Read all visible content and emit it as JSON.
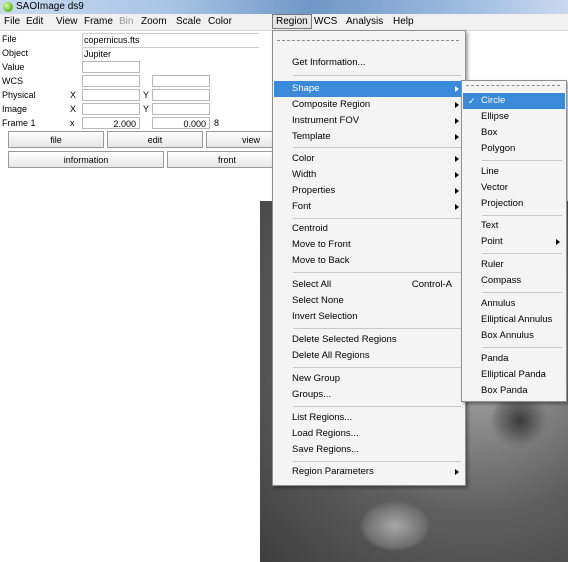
{
  "window": {
    "title": "SAOImage ds9"
  },
  "menubar": [
    "File",
    "Edit",
    "View",
    "Frame",
    "Bin",
    "Zoom",
    "Scale",
    "Color",
    "Region",
    "WCS",
    "Analysis",
    "Help"
  ],
  "info_panel": {
    "file_label": "File",
    "file_value": "copernicus.fts",
    "object_label": "Object",
    "object_value": "Jupiter",
    "value_label": "Value",
    "wcs_label": "WCS",
    "physical_label": "Physical",
    "physical_x": "X",
    "physical_y": "Y",
    "image_label": "Image",
    "image_x": "X",
    "image_y": "Y",
    "frame_label": "Frame 1",
    "frame_x": "x",
    "frame_zoom": "2.000",
    "frame_angle": "0.000",
    "frame_unit": "8"
  },
  "buttons_row1": [
    "file",
    "edit",
    "view"
  ],
  "buttons_row2": [
    "information",
    "front"
  ],
  "region_menu": {
    "get_information": "Get Information...",
    "shape": "Shape",
    "composite_region": "Composite Region",
    "instrument_fov": "Instrument FOV",
    "template": "Template",
    "color": "Color",
    "width": "Width",
    "properties": "Properties",
    "font": "Font",
    "centroid": "Centroid",
    "move_to_front": "Move to Front",
    "move_to_back": "Move to Back",
    "select_all": "Select All",
    "select_all_accel": "Control-A",
    "select_none": "Select None",
    "invert_selection": "Invert Selection",
    "delete_selected": "Delete Selected Regions",
    "delete_all": "Delete All Regions",
    "new_group": "New Group",
    "groups": "Groups...",
    "list_regions": "List Regions...",
    "load_regions": "Load Regions...",
    "save_regions": "Save Regions...",
    "region_parameters": "Region Parameters"
  },
  "shape_menu": {
    "circle": "Circle",
    "ellipse": "Ellipse",
    "box": "Box",
    "polygon": "Polygon",
    "line": "Line",
    "vector": "Vector",
    "projection": "Projection",
    "text": "Text",
    "point": "Point",
    "ruler": "Ruler",
    "compass": "Compass",
    "annulus": "Annulus",
    "elliptical_annulus": "Elliptical Annulus",
    "box_annulus": "Box Annulus",
    "panda": "Panda",
    "elliptical_panda": "Elliptical Panda",
    "box_panda": "Box Panda",
    "check_mark": "✓"
  },
  "colors": {
    "highlight": "#3a8ad9",
    "menu_bg": "#f4f4f4"
  }
}
